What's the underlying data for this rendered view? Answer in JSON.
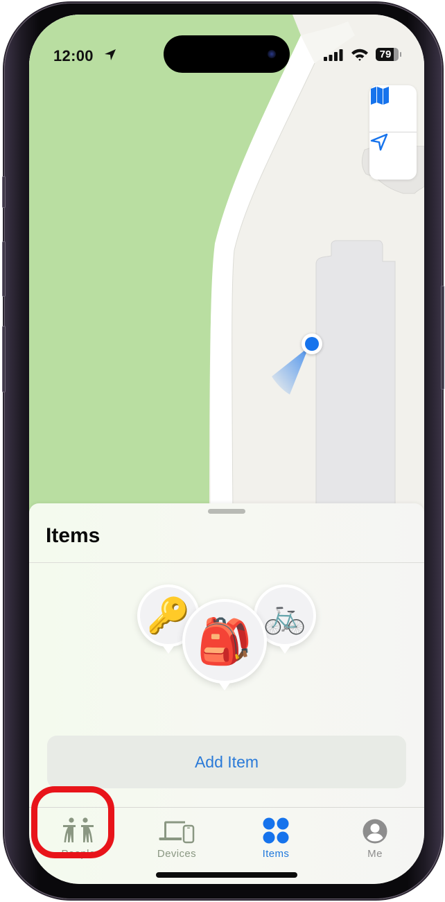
{
  "status_bar": {
    "time": "12:00",
    "location_services_icon": "location-arrow-icon",
    "signal_icon": "cellular-signal-icon",
    "wifi_icon": "wifi-icon",
    "battery_percent": "79",
    "battery_level": 0.79
  },
  "map": {
    "controls": [
      {
        "name": "map-mode-button",
        "icon": "map-icon"
      },
      {
        "name": "recenter-location-button",
        "icon": "location-arrow-icon"
      }
    ],
    "user_location": {
      "icon": "user-location-dot",
      "heading": "southwest"
    },
    "colors": {
      "park": "#b9dea1",
      "land": "#f2f1ec",
      "road": "#ffffff",
      "building": "#e6e6e8",
      "accent": "#1673ec"
    }
  },
  "sheet": {
    "title": "Items",
    "items": [
      {
        "name": "Keys",
        "emoji": "🔑"
      },
      {
        "name": "Backpack",
        "emoji": "🎒"
      },
      {
        "name": "Bike",
        "emoji": "🚲"
      }
    ],
    "add_item_label": "Add Item"
  },
  "tabbar": {
    "tabs": [
      {
        "label": "People",
        "icon": "people-icon",
        "active": false
      },
      {
        "label": "Devices",
        "icon": "devices-icon",
        "active": false
      },
      {
        "label": "Items",
        "icon": "items-icon",
        "active": true
      },
      {
        "label": "Me",
        "icon": "person-circle-icon",
        "active": false
      }
    ],
    "active_color": "#1f78dc",
    "inactive_color": "#8a9782"
  },
  "annotation": {
    "target": "People",
    "color": "#e8141a"
  }
}
